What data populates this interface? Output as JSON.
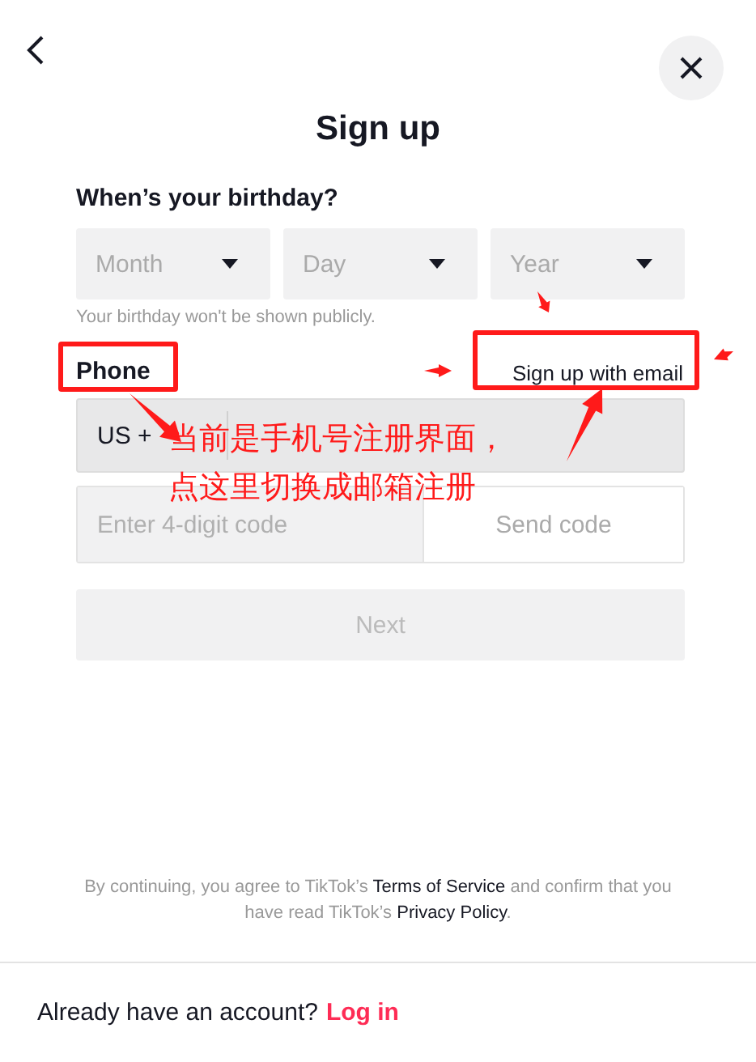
{
  "header": {
    "title": "Sign up"
  },
  "birthday": {
    "label": "When’s your birthday?",
    "selects": [
      {
        "placeholder": "Month"
      },
      {
        "placeholder": "Day"
      },
      {
        "placeholder": "Year"
      }
    ],
    "hint": "Your birthday won't be shown publicly."
  },
  "phone": {
    "label": "Phone",
    "switch_link": "Sign up with email",
    "country_code": "US +"
  },
  "code": {
    "placeholder": "Enter 4-digit code",
    "send_button": "Send code"
  },
  "next_button": {
    "label": "Next",
    "disabled": true
  },
  "terms": [
    {
      "kind": "plain",
      "text": "By continuing, you agree to TikTok’s"
    },
    {
      "kind": "link",
      "text": "Terms of Service"
    },
    {
      "kind": "plain",
      "text": "and confirm that you have read TikTok’s"
    },
    {
      "kind": "link",
      "text": "Privacy Policy"
    },
    {
      "kind": "plain",
      "text": "."
    }
  ],
  "footer": {
    "text": "Already have an account?",
    "link": "Log in"
  },
  "annotation": {
    "lines": [
      "当前是手机号注册界面，",
      "点这里切换成邮箱注册"
    ]
  }
}
